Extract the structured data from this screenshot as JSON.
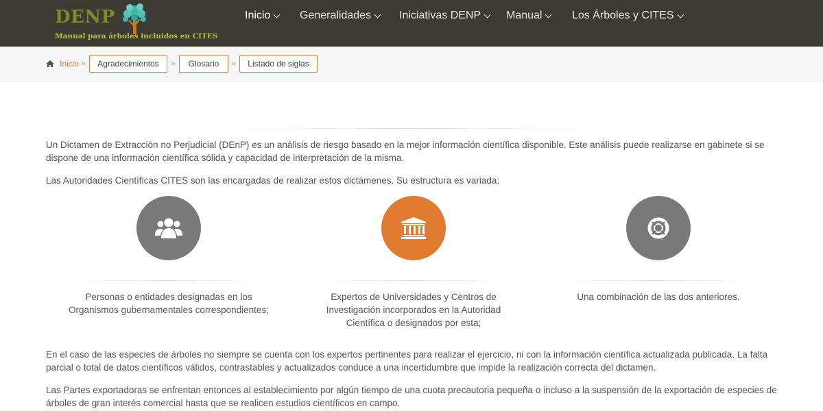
{
  "header": {
    "logo_title": "DENP",
    "logo_subtitle": "Manual para árboles incluidos en CITES",
    "nav": [
      {
        "label": "Inicio",
        "active": true
      },
      {
        "label": "Generalidades"
      },
      {
        "label": "Iniciativas DENP"
      },
      {
        "label": "Manual"
      },
      {
        "label": "Los Árboles y CITES"
      }
    ]
  },
  "breadcrumb": {
    "home": "Inicio",
    "separator": "»",
    "links": [
      "Agradecimientos",
      "Glosario",
      "Listado de siglas"
    ]
  },
  "main": {
    "intro_p1": "Un Dictamen de Extracción no Perjudicial (DEnP) es un análisis de riesgo basado en la mejor información científica disponible. Este análisis puede realizarse en gabinete si se dispone de una información científica sólida y capacidad de interpretación de la misma.",
    "intro_p2": "Las Autoridades Científicas CITES son las encargadas de realizar estos dictámenes. Su estructura es variada:",
    "features": [
      {
        "icon": "users-icon",
        "text": "Personas o entidades designadas en los Organismos gubernamentales correspondientes;"
      },
      {
        "icon": "institution-icon",
        "text": "Expertos de Universidades y Centros de Investigación incorporados en la Autoridad Científica o designados por esta;"
      },
      {
        "icon": "life-ring-icon",
        "text": "Una combinación de las dos anteriores."
      }
    ],
    "body_p1": "En el caso de las especies de árboles no siempre se cuenta con los expertos pertinentes para realizar el ejercicio, ni con la información científica actualizada publicada. La falta parcial o total de datos científicos válidos, contrastables y actualizados conduce a una incertidumbre que impide la realización correcta del dictamen.",
    "body_p2": "Las Partes exportadoras se enfrentan entonces al establecimiento por algún tiempo de una cuota precautoria pequeña o incluso a la suspensión de la exportación de especies de árboles de gran interés comercial hasta que se realicen estudios científicos en campo."
  },
  "colors": {
    "header_bg": "#3d3933",
    "accent": "#e07b30",
    "icon_grey": "#797979",
    "logo_green": "#7c8b2a"
  }
}
